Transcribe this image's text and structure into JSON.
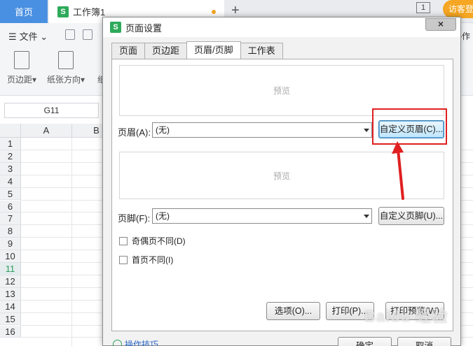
{
  "app": {
    "tabs": {
      "home": "首页",
      "doc": "工作簿1",
      "add": "+"
    },
    "page_indicator": "1",
    "visitor": "访客登录",
    "menu": {
      "file": "文件",
      "right": "协作"
    },
    "toolbar": [
      {
        "label": "页边距",
        "icon": "margin-icon"
      },
      {
        "label": "纸张方向",
        "icon": "orientation-icon"
      },
      {
        "label": "纸",
        "icon": "paper-icon"
      }
    ],
    "namebox": "G11",
    "columns": [
      "A",
      "B"
    ],
    "rows": [
      "1",
      "2",
      "3",
      "4",
      "5",
      "6",
      "7",
      "8",
      "9",
      "10",
      "11",
      "12",
      "13",
      "14",
      "15",
      "16"
    ],
    "active_row": "11"
  },
  "dialog": {
    "title": "页面设置",
    "close": "×",
    "tabs": [
      "页面",
      "页边距",
      "页眉/页脚",
      "工作表"
    ],
    "active_tab": "页眉/页脚",
    "header_preview": "预览",
    "header_label": "页眉(A):",
    "header_value": "(无)",
    "custom_header_button": "自定义页眉(C)...",
    "footer_preview": "预览",
    "footer_label": "页脚(F):",
    "footer_value": "(无)",
    "custom_footer_button": "自定义页脚(U)...",
    "odd_even_label": "奇偶页不同(D)",
    "first_page_label": "首页不同(I)",
    "options_button": "选项(O)...",
    "print_button": "打印(P)...",
    "print_preview_button": "打印预览(W)",
    "tips_link": "操作技巧",
    "ok_button": "确定",
    "cancel_button": "取消"
  },
  "watermark": "Baidu 经验",
  "colors": {
    "accent": "#4a90e2",
    "annotation": "#e02020",
    "wps_green": "#2eaa5a"
  }
}
